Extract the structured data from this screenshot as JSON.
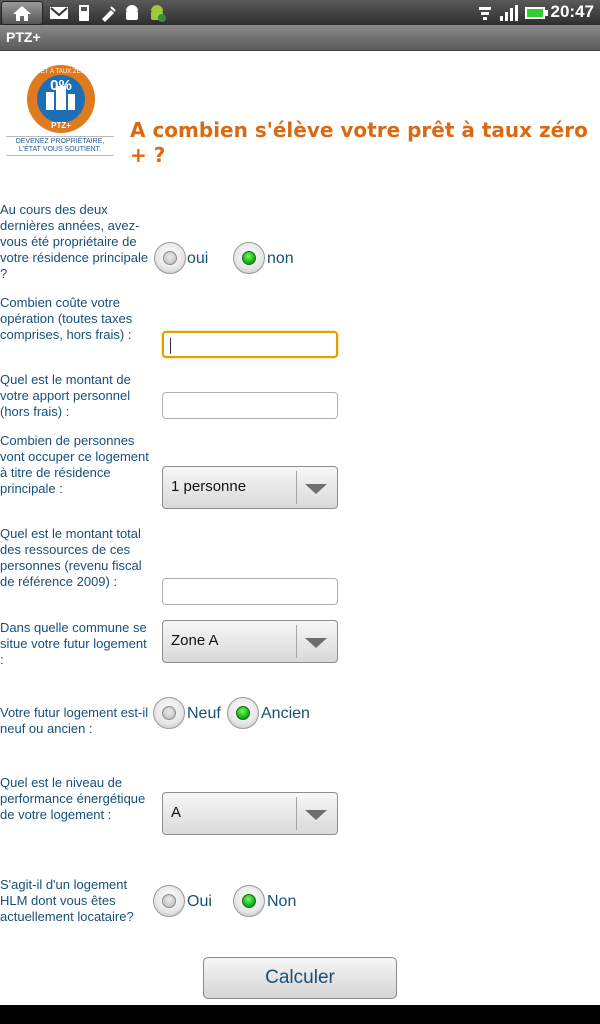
{
  "status_bar": {
    "time": "20:47",
    "left_icons": [
      "home-icon",
      "gmail-icon",
      "sd-card-icon",
      "usb-debug-icon",
      "android-icon",
      "android-update-icon"
    ],
    "right_icons": [
      "wifi-icon",
      "signal-icon",
      "battery-icon"
    ]
  },
  "app": {
    "title": "PTZ+"
  },
  "logo": {
    "arc_text": "PRÊT À TAUX ZÉRO",
    "percent": "0%",
    "brand": "PTZ+",
    "tagline_1": "DEVENEZ PROPRIÉTAIRE,",
    "tagline_2": "L'ÉTAT VOUS SOUTIENT."
  },
  "heading": "A combien s'élève votre prêt à taux zéro + ?",
  "questions": {
    "q1": "Au cours des deux dernières années, avez-vous été propriétaire de votre résidence principale ?",
    "q2": "Combien coûte votre opération (toutes taxes comprises, hors frais) :",
    "q3": "Quel est le montant de votre apport personnel (hors frais) :",
    "q4": "Combien de personnes vont occuper ce logement à titre de résidence principale :",
    "q5": "Quel est le montant total des ressources de ces personnes (revenu fiscal de référence 2009) :",
    "q6": "Dans quelle commune se situe votre futur logement :",
    "q7": "Votre futur logement est-il neuf ou ancien :",
    "q8": "Quel est le niveau de performance énergétique de votre logement :",
    "q9": "S'agit-il d'un logement HLM dont vous êtes actuellement locataire?"
  },
  "options": {
    "q1_yes": "oui",
    "q1_no": "non",
    "q7_new": "Neuf",
    "q7_old": "Ancien",
    "q9_yes": "Oui",
    "q9_no": "Non"
  },
  "selected": {
    "q1": "non",
    "q7": "Ancien",
    "q9": "Non"
  },
  "inputs": {
    "cost": "",
    "contribution": "",
    "income": ""
  },
  "spinners": {
    "persons": "1 personne",
    "zone": "Zone A",
    "energy": "A"
  },
  "button": {
    "calculate": "Calculer"
  },
  "colors": {
    "heading": "#d96a14",
    "label": "#174f7a",
    "radio_checked": "#0fa515",
    "focus_border": "#e0a000"
  }
}
